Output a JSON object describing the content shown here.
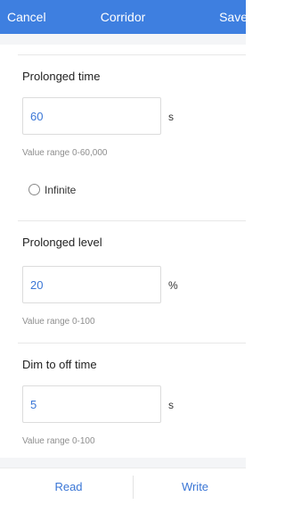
{
  "header": {
    "cancel_label": "Cancel",
    "title": "Corridor",
    "save_label": "Save",
    "accent_color": "#3e7fe0"
  },
  "prolonged_time": {
    "label": "Prolonged time",
    "value": "60",
    "unit": "s",
    "hint": "Value range 0-60,000",
    "infinite_label": "Infinite",
    "infinite_checked": false
  },
  "prolonged_level": {
    "label": "Prolonged level",
    "value": "20",
    "unit": "%",
    "hint": "Value range 0-100"
  },
  "dim_to_off": {
    "label": "Dim to off time",
    "value": "5",
    "unit": "s",
    "hint": "Value range 0-100"
  },
  "footer": {
    "read_label": "Read",
    "write_label": "Write"
  }
}
